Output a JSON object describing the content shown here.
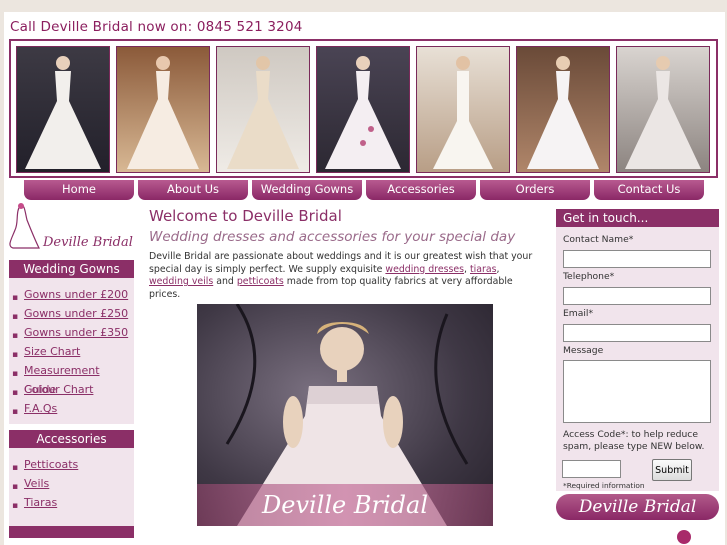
{
  "header": {
    "phone": "Call Deville Bridal now on: 0845 521 3204"
  },
  "banner": {
    "images": [
      "dress-1",
      "dress-2",
      "dress-3",
      "dress-4",
      "dress-5",
      "dress-6",
      "dress-7"
    ]
  },
  "nav": [
    "Home",
    "About Us",
    "Wedding Gowns",
    "Accessories",
    "Orders",
    "Contact Us"
  ],
  "brand": {
    "logo_text": "Deville Bridal"
  },
  "sidebar": {
    "gowns_heading": "Wedding Gowns",
    "gowns_items": [
      "Gowns under £200",
      "Gowns under £250",
      "Gowns under £350",
      "Size Chart",
      "Measurement Guide",
      "Colour Chart",
      "F.A.Qs"
    ],
    "accessories_heading": "Accessories",
    "accessories_items": [
      "Petticoats",
      "Veils",
      "Tiaras"
    ]
  },
  "main": {
    "title": "Welcome to Deville Bridal",
    "tagline": "Wedding dresses and accessories for your special day",
    "intro_1": "Deville Bridal are passionate about weddings and it is our greatest wish that your special day is simply perfect. We supply exquisite ",
    "link_dresses": "wedding dresses",
    "sep_1": ", ",
    "link_tiaras": "tiaras",
    "sep_2": ", ",
    "link_veils": "wedding veils",
    "sep_3": " and ",
    "link_petticoats": "petticoats",
    "intro_2": " made from top quality fabrics at very affordable prices.",
    "hero_caption": "Deville Bridal"
  },
  "contact": {
    "heading": "Get in touch...",
    "name_label": "Contact Name*",
    "phone_label": "Telephone*",
    "email_label": "Email*",
    "message_label": "Message",
    "captcha_text": "Access Code*: to help reduce spam, please type NEW below.",
    "submit": "Submit",
    "required": "*Required information"
  },
  "colors": {
    "brand": "#8b2f67",
    "sidebar_bg": "#f1e4ec"
  }
}
